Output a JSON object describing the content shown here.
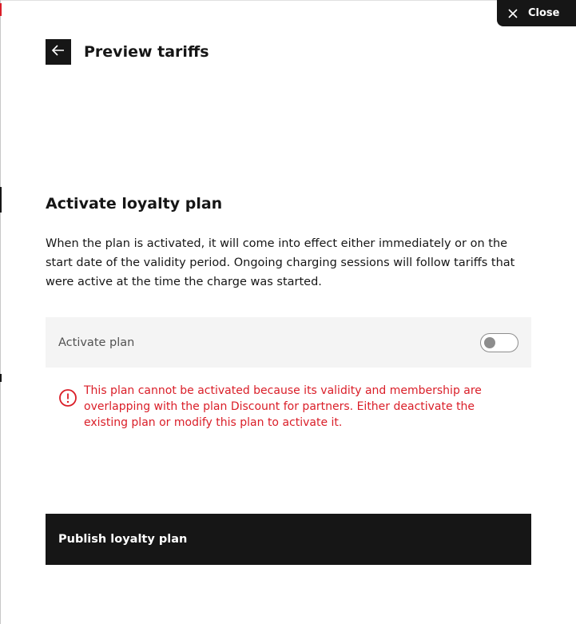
{
  "close_button": {
    "label": "Close",
    "icon": "close-icon"
  },
  "header": {
    "title": "Preview tariffs",
    "back_icon": "arrow-left-icon"
  },
  "section": {
    "title": "Activate loyalty plan",
    "description": "When the plan is activated, it will come into effect either immediately or on the start date of the validity period. Ongoing charging sessions will follow tariffs that were active at the time the charge was started."
  },
  "toggle": {
    "label": "Activate plan",
    "on": false
  },
  "error": {
    "icon": "warning-circle-icon",
    "message": "This plan cannot be activated because its validity and membership are overlapping with the plan Discount for partners. Either deactivate the existing plan or modify this plan to activate it."
  },
  "publish_button": {
    "label": "Publish loyalty plan"
  },
  "colors": {
    "primary": "#161616",
    "error": "#da1e28",
    "field_background": "#f4f4f4",
    "toggle_off": "#8d8d8d"
  }
}
